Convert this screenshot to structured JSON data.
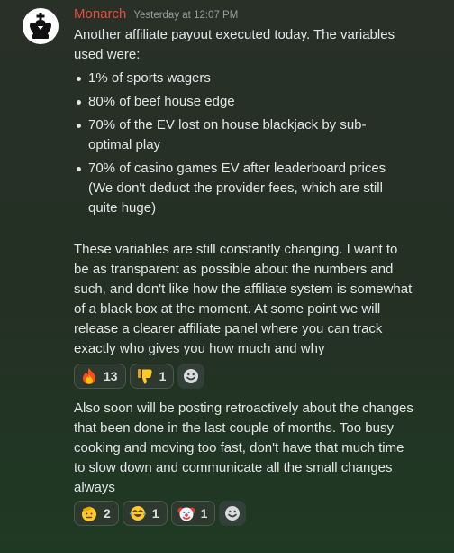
{
  "author": {
    "name": "Monarch",
    "color": "#e74c3c",
    "avatar_icon": "chess-king-icon"
  },
  "timestamp": "Yesterday at 12:07 PM",
  "intro": "Another affiliate payout executed today. The variables used were:",
  "bullets": [
    "1% of sports wagers",
    "80% of beef house edge",
    "70% of the EV lost on house blackjack by sub-optimal play",
    "70% of casino games EV after leaderboard prices (We don't deduct the provider fees, which are still quite huge)"
  ],
  "paragraph2": "These variables are still constantly changing. I want to be as transparent as possible about the numbers and such, and don't like how the affiliate system is somewhat of a black box at the moment. At some point we will release a clearer affiliate panel where you can track exactly who gives you how much and why",
  "reactions1": [
    {
      "emoji": "fire-icon",
      "count": "13"
    },
    {
      "emoji": "thumbs-down-icon",
      "count": "1"
    }
  ],
  "paragraph3": "Also soon will be posting retroactively about the changes that been done in the last couple of months. Too busy cooking and moving too fast, don't have that much time to slow down and communicate all the small changes always",
  "reactions2": [
    {
      "emoji": "saluting-face-icon",
      "count": "2"
    },
    {
      "emoji": "tears-of-joy-icon",
      "count": "1"
    },
    {
      "emoji": "clown-face-icon",
      "count": "1"
    }
  ],
  "add_reaction_icon": "add-reaction-icon"
}
